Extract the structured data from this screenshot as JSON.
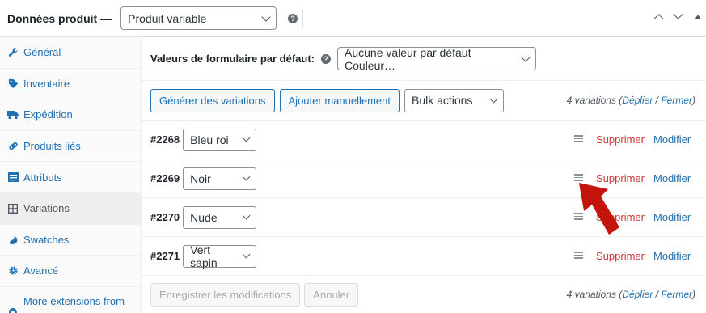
{
  "header": {
    "title": "Données produit —",
    "product_type": "Produit variable",
    "help_glyph": "?"
  },
  "sidebar": {
    "items": [
      {
        "label": "Général",
        "icon": "wrench-icon"
      },
      {
        "label": "Inventaire",
        "icon": "tag-icon"
      },
      {
        "label": "Expédition",
        "icon": "truck-icon"
      },
      {
        "label": "Produits liés",
        "icon": "link-icon"
      },
      {
        "label": "Attributs",
        "icon": "list-icon"
      },
      {
        "label": "Variations",
        "icon": "grid-icon"
      },
      {
        "label": "Swatches",
        "icon": "swatches-icon"
      },
      {
        "label": "Avancé",
        "icon": "gear-icon"
      },
      {
        "label": "More extensions from",
        "icon": "extensions-icon"
      }
    ]
  },
  "defaults": {
    "label": "Valeurs de formulaire par défaut:",
    "select_value": "Aucune valeur par défaut Couleur…"
  },
  "toolbar": {
    "generate_label": "Générer des variations",
    "add_label": "Ajouter manuellement",
    "bulk_label": "Bulk actions"
  },
  "summary": {
    "count_text": "4 variations (",
    "expand": "Déplier",
    "sep": " / ",
    "collapse": "Fermer",
    "close_paren": ")"
  },
  "variations": [
    {
      "id": "#2268",
      "value": "Bleu roi"
    },
    {
      "id": "#2269",
      "value": "Noir"
    },
    {
      "id": "#2270",
      "value": "Nude"
    },
    {
      "id": "#2271",
      "value": "Vert sapin"
    }
  ],
  "row_actions": {
    "delete": "Supprimer",
    "edit": "Modifier"
  },
  "footer": {
    "save_label": "Enregistrer les modifications",
    "cancel_label": "Annuler"
  },
  "colors": {
    "link": "#2271b1",
    "danger": "#d63638",
    "arrow": "#c4150c"
  }
}
